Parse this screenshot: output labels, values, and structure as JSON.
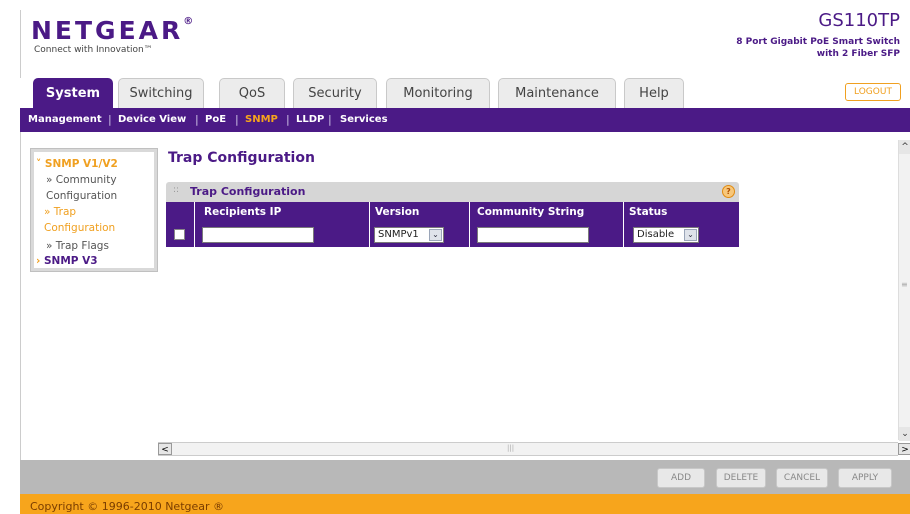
{
  "header": {
    "brand": "NETGEAR",
    "brand_mark": "®",
    "tagline": "Connect with Innovation™",
    "model": "GS110TP",
    "model_desc_1": "8 Port Gigabit PoE Smart Switch",
    "model_desc_2": "with 2 Fiber SFP"
  },
  "tabs": [
    {
      "label": "System",
      "active": true
    },
    {
      "label": "Switching"
    },
    {
      "label": "QoS"
    },
    {
      "label": "Security"
    },
    {
      "label": "Monitoring"
    },
    {
      "label": "Maintenance"
    },
    {
      "label": "Help"
    }
  ],
  "logout_label": "LOGOUT",
  "subnav": [
    {
      "label": "Management"
    },
    {
      "label": "Device View"
    },
    {
      "label": "PoE"
    },
    {
      "label": "SNMP",
      "active": true
    },
    {
      "label": "LLDP"
    },
    {
      "label": "Services"
    }
  ],
  "subnav_separator": "|",
  "leftnav": {
    "group1": "SNMP V1/V2",
    "group1_marker": "˅",
    "items": [
      {
        "bullet": "»",
        "line1": "Community",
        "line2": "Configuration"
      },
      {
        "bullet": "»",
        "line1": "Trap",
        "line2": "Configuration",
        "selected": true
      },
      {
        "bullet": "»",
        "line1": "Trap Flags"
      }
    ],
    "group2": "SNMP V3",
    "group2_marker": "›"
  },
  "page_title": "Trap Configuration",
  "panel": {
    "title": "Trap Configuration",
    "grip": "::",
    "help_symbol": "?",
    "columns": [
      "Recipients IP",
      "Version",
      "Community String",
      "Status"
    ],
    "row": {
      "recipients_ip": "",
      "version": "SNMPv1",
      "community_string": "",
      "status": "Disable"
    }
  },
  "icons": {
    "dropdown": "⌄",
    "scroll_up": "^",
    "scroll_down": "⌄",
    "scroll_left": "<",
    "scroll_right": ">",
    "grip_h": "|||",
    "grip_v": "≡"
  },
  "buttons": {
    "add": "ADD",
    "delete": "DELETE",
    "cancel": "CANCEL",
    "apply": "APPLY"
  },
  "copyright": "Copyright © 1996-2010 Netgear ®",
  "colors": {
    "brand_purple": "#4b1a86",
    "accent_orange": "#f7a51c"
  }
}
